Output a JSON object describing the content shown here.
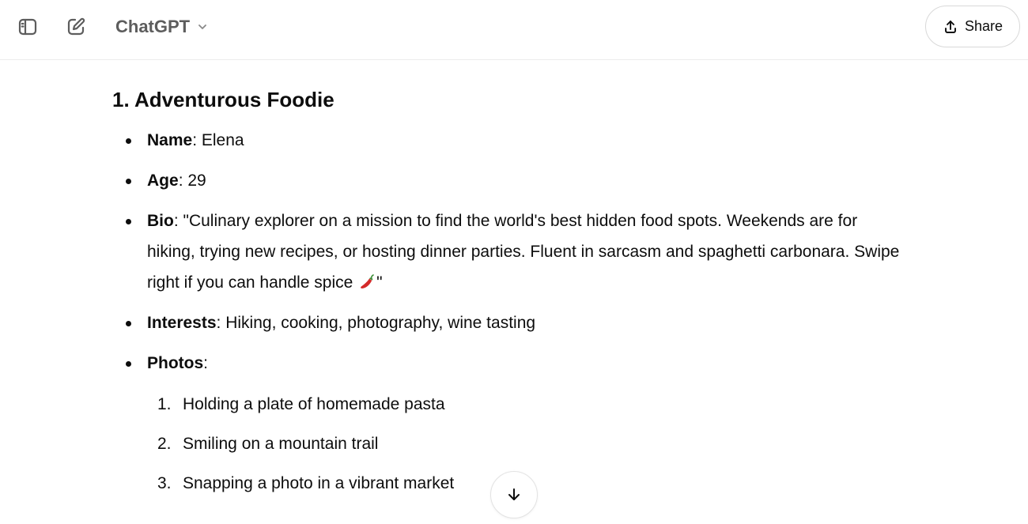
{
  "header": {
    "model_name": "ChatGPT",
    "share_label": "Share",
    "icons": {
      "sidebar_toggle": "sidebar-toggle-icon",
      "new_chat": "new-chat-icon",
      "model_dropdown": "chevron-down-icon",
      "share": "share-icon"
    }
  },
  "message": {
    "heading": "1. Adventurous Foodie",
    "profile": {
      "name_label": "Name",
      "name_value": ": Elena",
      "age_label": "Age",
      "age_value": ": 29",
      "bio_label": "Bio",
      "bio_value": ": \"Culinary explorer on a mission to find the world's best hidden food spots. Weekends are for hiking, trying new recipes, or hosting dinner parties. Fluent in sarcasm and spaghetti carbonara. Swipe right if you can handle spice ",
      "bio_end": "\"",
      "interests_label": "Interests",
      "interests_value": ": Hiking, cooking, photography, wine tasting",
      "photos_label": "Photos",
      "photos_suffix": ":"
    },
    "photos": [
      {
        "num": "1.",
        "text": "Holding a plate of homemade pasta"
      },
      {
        "num": "2.",
        "text": "Smiling on a mountain trail"
      },
      {
        "num": "3.",
        "text": "Snapping a photo in a vibrant market"
      }
    ]
  },
  "controls": {
    "scroll_down_icon": "arrow-down-icon"
  },
  "colors": {
    "text": "#0d0d0d",
    "muted": "#5d5d5d",
    "border": "#d9d9d9",
    "chili_red": "#d42a2a",
    "chili_green": "#3f8f3a"
  }
}
